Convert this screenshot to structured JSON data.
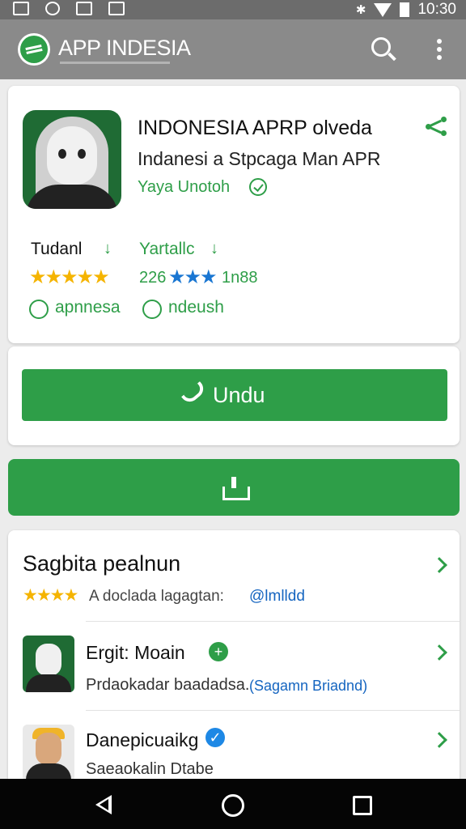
{
  "status_bar": {
    "time": "10:30",
    "bluetooth": "bluetooth-icon",
    "wifi": "wifi-icon",
    "battery": "battery-icon"
  },
  "app_bar": {
    "title": "APP INDESIA",
    "icons": [
      "search-icon",
      "more-vert-icon"
    ]
  },
  "app": {
    "title": "INDONESIA APRP olveda",
    "subtitle": "Indanesi a Stpcaga Man APR",
    "developer": "Yaya Unotoh",
    "stats": [
      {
        "label": "Tudanl",
        "arrow": "↓",
        "stars": "★★★★★",
        "star_color": "#f5b400"
      },
      {
        "label": "Yartallc",
        "arrow": "↓",
        "rating_prefix": "226",
        "stars": "★★★",
        "rating_suffix": "1n88",
        "star_color": "#1976d2"
      }
    ],
    "badges": [
      "apnnesa",
      "ndeush"
    ]
  },
  "install_button": {
    "label": "Undu",
    "icon": "phone-icon"
  },
  "download_bar": {
    "icon": "download-icon"
  },
  "similar": {
    "title": "Sagbita pealnun",
    "stars": "★★★★",
    "description": "A doclada lagagtan:",
    "link": "@lmlldd",
    "items": [
      {
        "name": "Ergit: Moain",
        "badge": "+",
        "badge_color": "#2e9e48",
        "description": "Prdaokadar baadadsa.",
        "link": "(Sagamn Briadnd)"
      },
      {
        "name": "Danepicuaikg",
        "badge": "✓",
        "badge_color": "#1e88e5",
        "description": "Saeaokalin Dtabe",
        "link": ""
      }
    ]
  },
  "nav_bar": {
    "icons": [
      "back-icon",
      "home-icon",
      "recents-icon"
    ]
  },
  "colors": {
    "accent": "#2e9e48",
    "star": "#f5b400",
    "link": "#1565c0",
    "appbar": "#8a8a8a"
  }
}
